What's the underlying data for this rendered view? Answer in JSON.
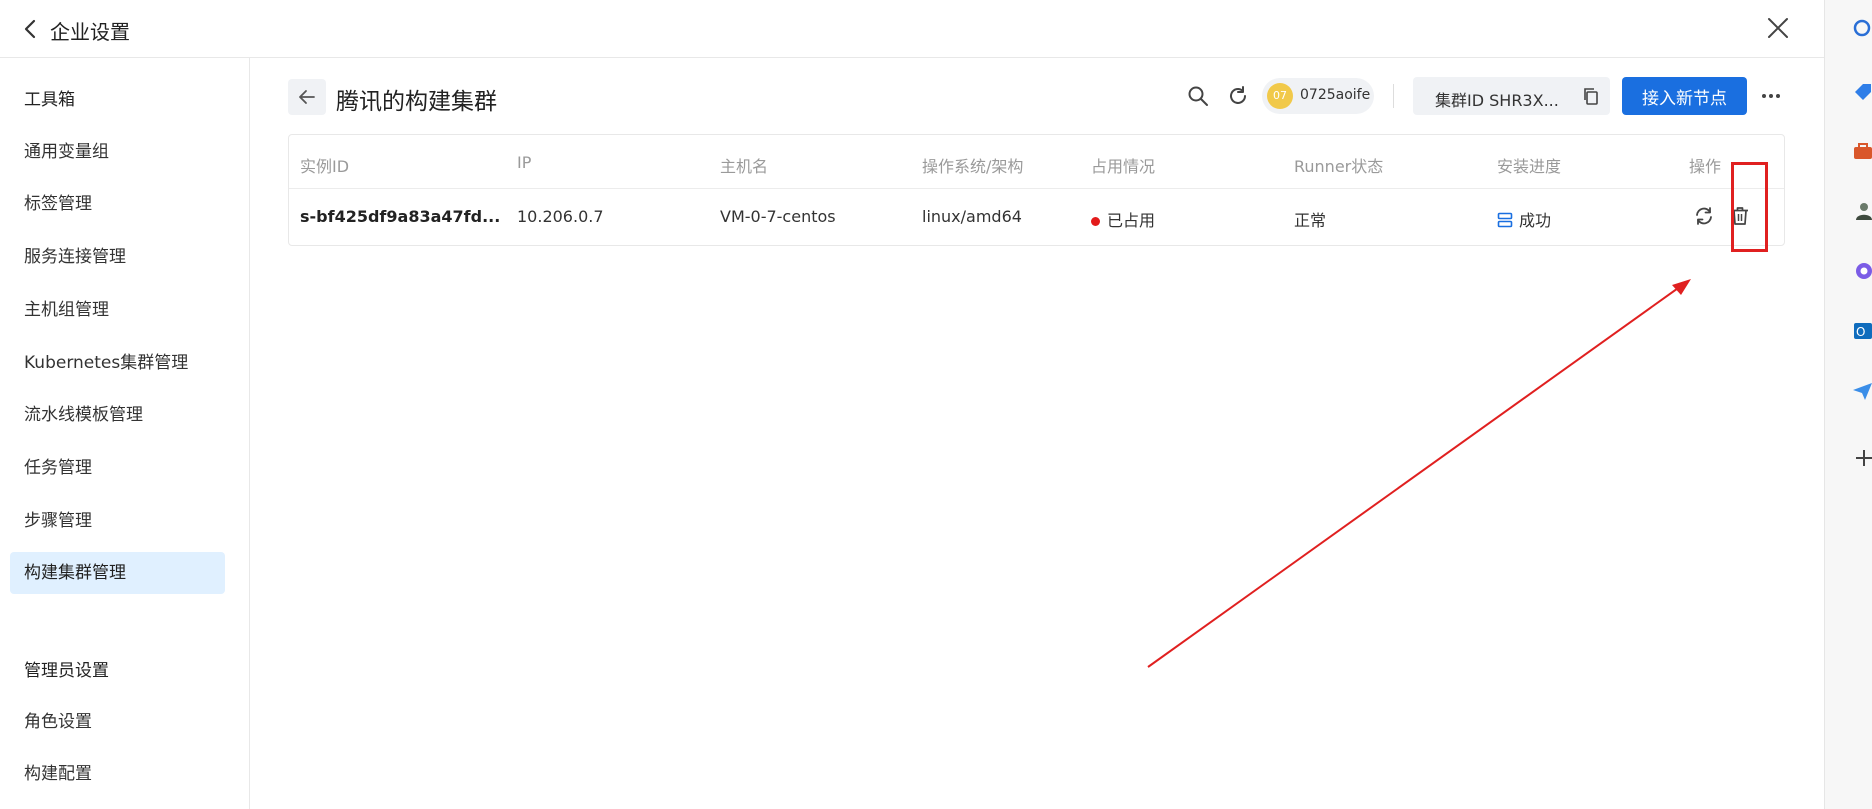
{
  "header": {
    "title": "企业设置"
  },
  "sidebar": {
    "section_1": "工具箱",
    "items_1": [
      "通用变量组",
      "标签管理",
      "服务连接管理",
      "主机组管理",
      "Kubernetes集群管理",
      "流水线模板管理",
      "任务管理",
      "步骤管理",
      "构建集群管理"
    ],
    "active_index": 8,
    "section_2": "管理员设置",
    "items_2": [
      "角色设置",
      "构建配置"
    ]
  },
  "page": {
    "title": "腾讯的构建集群"
  },
  "toolbar": {
    "user_avatar": "07",
    "user_name": "0725aoife",
    "cluster_id_label": "集群ID SHR3X...",
    "add_node_label": "接入新节点"
  },
  "table": {
    "headers": [
      "实例ID",
      "IP",
      "主机名",
      "操作系统/架构",
      "占用情况",
      "Runner状态",
      "安装进度",
      "操作"
    ],
    "rows": [
      {
        "instance_id": "s-bf425df9a83a47fd...",
        "ip": "10.206.0.7",
        "hostname": "VM-0-7-centos",
        "os_arch": "linux/amd64",
        "occupancy": "已占用",
        "runner_status": "正常",
        "install_progress": "成功"
      }
    ]
  },
  "colors": {
    "primary": "#1a6fe0",
    "occupied_dot": "#e31b1b",
    "annotation": "#e02020",
    "active_bg": "#e0f0ff"
  }
}
